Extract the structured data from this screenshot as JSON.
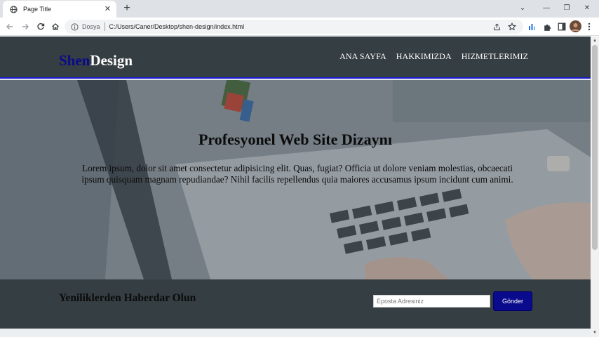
{
  "browser": {
    "tab_title": "Page Title",
    "new_tab": "+",
    "url_label": "Dosya",
    "url": "C:/Users/Caner/Desktop/shen-design/index.html",
    "colors": {
      "tabstrip": "#dee1e6",
      "toolbar": "#ffffff",
      "accent_icon": "#1a73e8"
    },
    "icons": {
      "tab_favicon": "globe-icon",
      "back": "arrow-left-icon",
      "forward": "arrow-right-icon",
      "reload": "reload-icon",
      "home": "home-icon",
      "site_info": "info-icon",
      "share": "share-icon",
      "bookmark": "star-icon",
      "extension_1": "extension-blue-icon",
      "extensions": "puzzle-icon",
      "side_panel": "side-panel-icon",
      "profile": "avatar-icon",
      "menu": "more-vertical-icon"
    }
  },
  "site": {
    "logo_accent": "Shen",
    "logo_rest": "Design",
    "nav": [
      "ANA SAYFA",
      "HAKKIMIZDA",
      "HIZMETLERIMIZ"
    ],
    "colors": {
      "header_bg": "#353e42",
      "accent": "#0a0a8c",
      "header_border": "#1b1bd4"
    }
  },
  "hero": {
    "title": "Profesyonel Web Site Dizaynı",
    "text": "Lorem ipsum, dolor sit amet consectetur adipisicing elit. Quas, fugiat? Officia ut dolore veniam molestias, obcaecati ipsum quisquam magnam repudiandae? Nihil facilis repellendus quia maiores accusamus ipsum incidunt cum animi."
  },
  "newsletter": {
    "heading": "Yeniliklerden Haberdar Olun",
    "email_placeholder": "Eposta Adresiniz",
    "email_value": "",
    "submit_label": "Gönder"
  }
}
